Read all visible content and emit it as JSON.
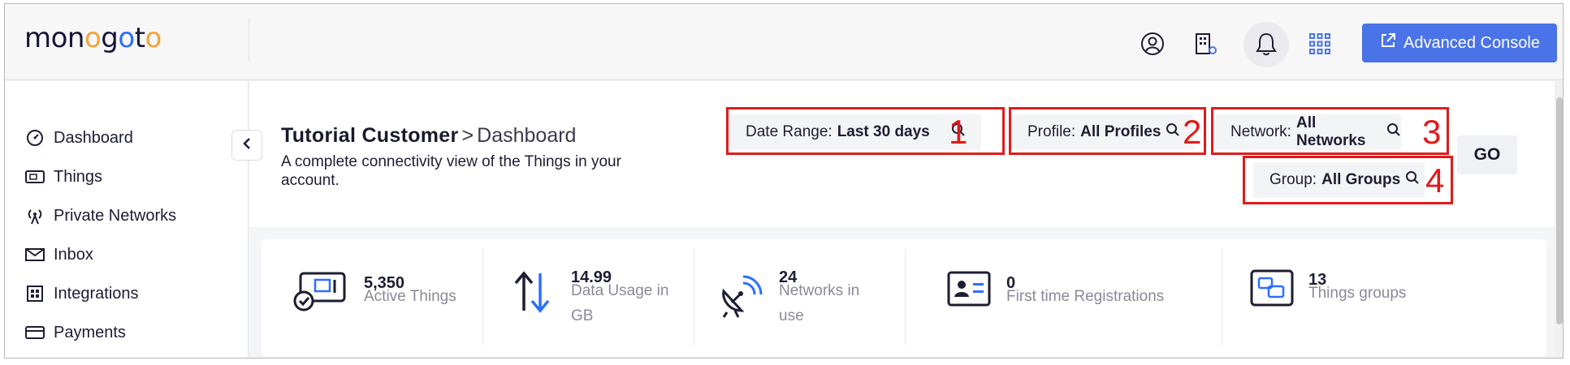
{
  "app": {
    "logo_text": "monogoto",
    "advanced_console_label": "Advanced Console"
  },
  "header_icons": [
    "user-icon",
    "building-settings-icon",
    "bell-icon",
    "apps-grid-icon"
  ],
  "sidebar": {
    "items": [
      {
        "label": "Dashboard",
        "icon": "dashboard-icon"
      },
      {
        "label": "Things",
        "icon": "sim-card-icon"
      },
      {
        "label": "Private Networks",
        "icon": "antenna-icon"
      },
      {
        "label": "Inbox",
        "icon": "mail-icon"
      },
      {
        "label": "Integrations",
        "icon": "integrations-icon"
      },
      {
        "label": "Payments",
        "icon": "credit-card-icon"
      }
    ]
  },
  "page": {
    "customer": "Tutorial Customer",
    "separator": ">",
    "crumb": "Dashboard",
    "subtitle": "A complete connectivity view of the Things in your account."
  },
  "filters": {
    "date_range": {
      "label": "Date Range:",
      "value": "Last 30 days",
      "callout": "1"
    },
    "profile": {
      "label": "Profile:",
      "value": "All Profiles",
      "callout": "2"
    },
    "network": {
      "label": "Network:",
      "value": "All Networks",
      "callout": "3"
    },
    "group": {
      "label": "Group:",
      "value": "All Groups",
      "callout": "4"
    },
    "go_label": "GO"
  },
  "stats": [
    {
      "value": "5,350",
      "label_line1": "Active Things",
      "label_line2": "",
      "icon": "sim-check-icon"
    },
    {
      "value": "14.99",
      "label_line1": "Data Usage in",
      "label_line2": "GB",
      "icon": "up-down-arrows-icon"
    },
    {
      "value": "24",
      "label_line1": "Networks in",
      "label_line2": "use",
      "icon": "satellite-dish-icon"
    },
    {
      "value": "0",
      "label_line1": "First time Registrations",
      "label_line2": "",
      "icon": "id-card-icon"
    },
    {
      "value": "13",
      "label_line1": "Things groups",
      "label_line2": "",
      "icon": "groups-icon"
    }
  ],
  "colors": {
    "accent": "#4a73e8",
    "callout": "#e01b1b",
    "arrow_blue": "#2b6fff"
  }
}
